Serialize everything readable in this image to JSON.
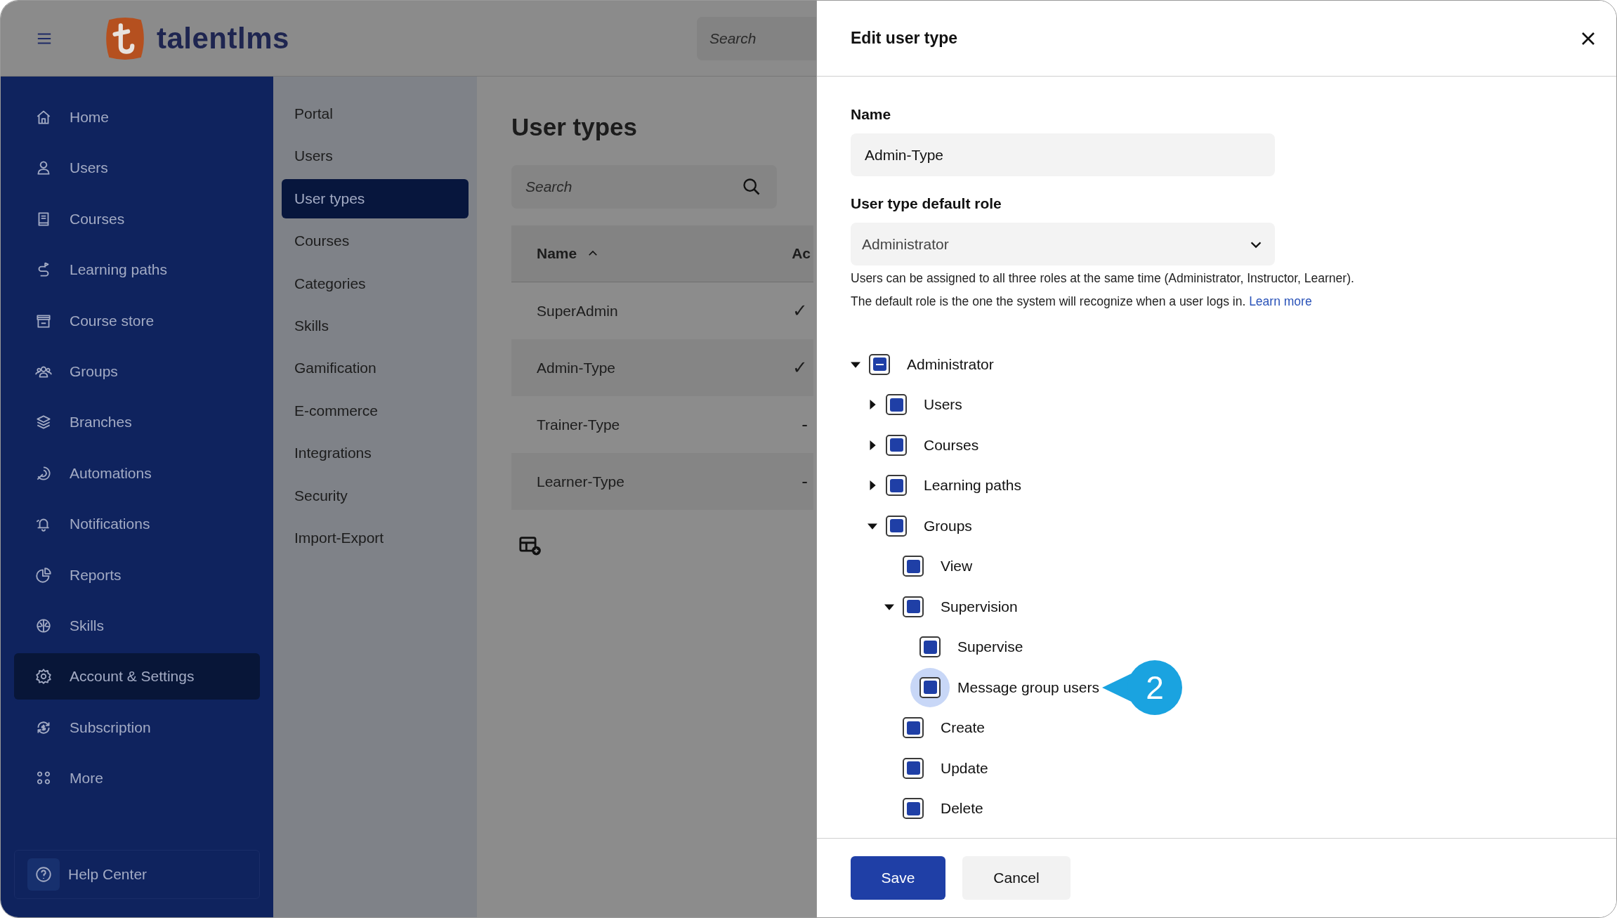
{
  "header": {
    "brand": "talentlms",
    "search": {
      "placeholder": "Search"
    }
  },
  "sidebar": {
    "items": [
      {
        "label": "Home",
        "selected": false
      },
      {
        "label": "Users",
        "selected": false
      },
      {
        "label": "Courses",
        "selected": false
      },
      {
        "label": "Learning paths",
        "selected": false
      },
      {
        "label": "Course store",
        "selected": false
      },
      {
        "label": "Groups",
        "selected": false
      },
      {
        "label": "Branches",
        "selected": false
      },
      {
        "label": "Automations",
        "selected": false
      },
      {
        "label": "Notifications",
        "selected": false
      },
      {
        "label": "Reports",
        "selected": false
      },
      {
        "label": "Skills",
        "selected": false
      },
      {
        "label": "Account & Settings",
        "selected": true
      },
      {
        "label": "Subscription",
        "selected": false
      },
      {
        "label": "More",
        "selected": false
      }
    ],
    "help": "Help Center"
  },
  "submenu": [
    {
      "label": "Portal",
      "selected": false
    },
    {
      "label": "Users",
      "selected": false
    },
    {
      "label": "User types",
      "selected": true
    },
    {
      "label": "Courses",
      "selected": false
    },
    {
      "label": "Categories",
      "selected": false
    },
    {
      "label": "Skills",
      "selected": false
    },
    {
      "label": "Gamification",
      "selected": false
    },
    {
      "label": "E-commerce",
      "selected": false
    },
    {
      "label": "Integrations",
      "selected": false
    },
    {
      "label": "Security",
      "selected": false
    },
    {
      "label": "Import-Export",
      "selected": false
    }
  ],
  "main": {
    "title": "User types",
    "search": {
      "placeholder": "Search"
    },
    "table": {
      "columns": [
        "Name",
        "Ac"
      ],
      "rows": [
        {
          "name": "SuperAdmin",
          "column_2": "✓"
        },
        {
          "name": "Admin-Type",
          "column_2": "✓"
        },
        {
          "name": "Trainer-Type",
          "column_2": "-"
        },
        {
          "name": "Learner-Type",
          "column_2": "-"
        }
      ]
    }
  },
  "drawer": {
    "title": "Edit user type",
    "name_label": "Name",
    "name_value": "Admin-Type",
    "role_label": "User type default role",
    "role_value": "Administrator",
    "help_lines": [
      "Users can be assigned to all three roles at the same time (Administrator, Instructor, Learner).",
      "The default role is the one the system will recognize when a user logs in."
    ],
    "learn_more": "Learn more",
    "permissions": [
      {
        "label": "Administrator",
        "checked": true,
        "indeterminate": true,
        "focused": false,
        "expanded": true,
        "children": [
          {
            "label": "Users",
            "checked": true,
            "indeterminate": false,
            "focused": false,
            "expanded": false
          },
          {
            "label": "Courses",
            "checked": true,
            "indeterminate": false,
            "focused": false,
            "expanded": false
          },
          {
            "label": "Learning paths",
            "checked": true,
            "indeterminate": false,
            "focused": false,
            "expanded": false
          },
          {
            "label": "Groups",
            "checked": true,
            "indeterminate": false,
            "focused": false,
            "expanded": true,
            "children": [
              {
                "label": "View",
                "checked": true,
                "indeterminate": false,
                "focused": false
              },
              {
                "label": "Supervision",
                "checked": true,
                "indeterminate": false,
                "focused": false,
                "expanded": true,
                "children": [
                  {
                    "label": "Supervise",
                    "checked": true,
                    "indeterminate": false,
                    "focused": false
                  },
                  {
                    "label": "Message group users",
                    "checked": true,
                    "indeterminate": false,
                    "focused": true,
                    "callout": "2"
                  }
                ]
              },
              {
                "label": "Create",
                "checked": true,
                "indeterminate": false,
                "focused": false
              },
              {
                "label": "Update",
                "checked": true,
                "indeterminate": false,
                "focused": false
              },
              {
                "label": "Delete",
                "checked": true,
                "indeterminate": false,
                "focused": false
              }
            ]
          }
        ]
      }
    ],
    "buttons": [
      "Save",
      "Cancel"
    ]
  }
}
